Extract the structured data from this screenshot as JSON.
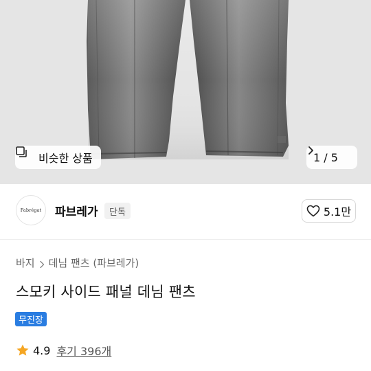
{
  "gallery": {
    "similar_button_label": "비슷한 상품",
    "counter": "1 / 5"
  },
  "shop": {
    "logo_text": "Fabrégat",
    "name": "파브레가",
    "badge": "단독",
    "likes": "5.1만"
  },
  "breadcrumb": {
    "items": [
      "바지",
      "데님 팬츠 (파브레가)"
    ]
  },
  "product": {
    "title": "스모키 사이드 패널 데님 팬츠",
    "tag": "무진장"
  },
  "rating": {
    "score": "4.9",
    "reviews_label": "후기 396개"
  },
  "colors": {
    "tag_blue": "#2a7de1",
    "star": "#f5a623"
  }
}
